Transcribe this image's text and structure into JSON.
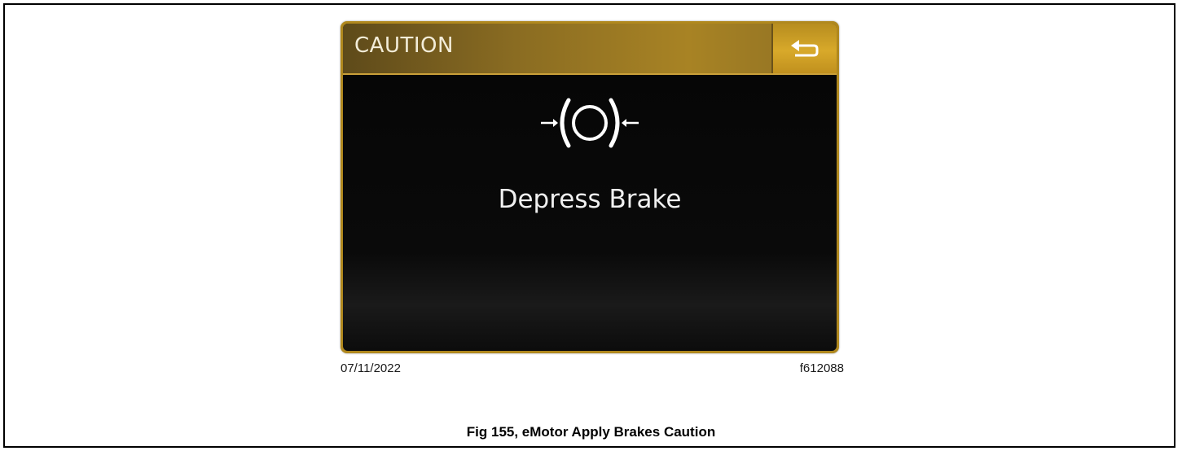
{
  "screen": {
    "header": {
      "title": "CAUTION",
      "back_button_icon": "return-arrow-icon"
    },
    "warning_icon": "brake-caution-icon",
    "message": "Depress Brake",
    "colors": {
      "header_gold": "#a88324",
      "button_gold": "#d8a92a",
      "screen_background": "#050505",
      "text_light": "#f0f0f0"
    }
  },
  "figure": {
    "date": "07/11/2022",
    "code": "f612088",
    "caption": "Fig 155, eMotor Apply Brakes Caution"
  }
}
